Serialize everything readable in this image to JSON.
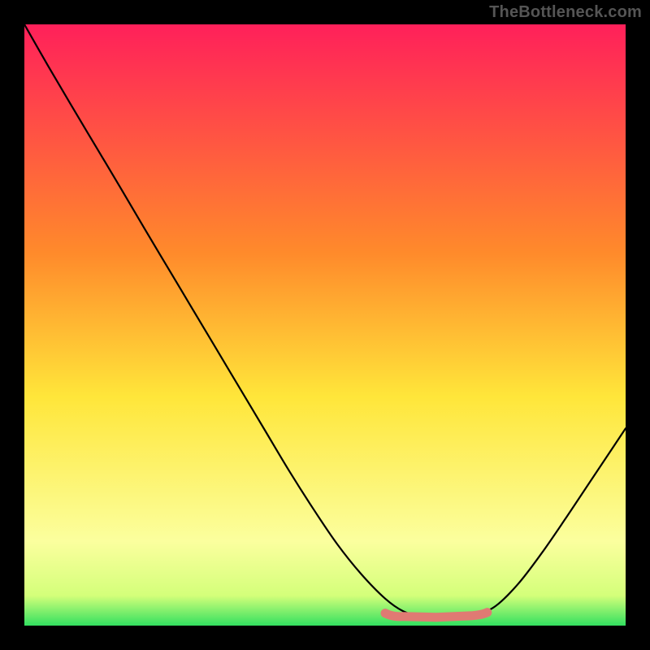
{
  "watermark": "TheBottleneck.com",
  "colors": {
    "frame": "#000000",
    "curve": "#000000",
    "band_fill": "#e07a73",
    "green_band": "#33e060",
    "gradient_top": "#ff205a",
    "gradient_mid1": "#ff8a2b",
    "gradient_mid2": "#ffe63a",
    "gradient_low": "#fbff9e",
    "gradient_bottom": "#33e060"
  },
  "chart_data": {
    "type": "line",
    "title": "",
    "xlabel": "",
    "ylabel": "",
    "xlim": [
      0,
      1
    ],
    "ylim": [
      0,
      1
    ],
    "grid": false,
    "series": [
      {
        "name": "bottleneck-curve",
        "x": [
          0.0,
          0.04,
          0.08,
          0.12,
          0.16,
          0.2,
          0.24,
          0.28,
          0.32,
          0.36,
          0.4,
          0.44,
          0.48,
          0.52,
          0.56,
          0.6,
          0.63,
          0.66,
          0.7,
          0.74,
          0.78,
          0.82,
          0.86,
          0.9,
          0.94,
          0.98,
          1.0
        ],
        "y": [
          1.0,
          0.93,
          0.862,
          0.795,
          0.728,
          0.66,
          0.593,
          0.526,
          0.459,
          0.392,
          0.325,
          0.258,
          0.195,
          0.136,
          0.086,
          0.045,
          0.024,
          0.015,
          0.013,
          0.016,
          0.03,
          0.068,
          0.12,
          0.178,
          0.238,
          0.298,
          0.328
        ]
      }
    ],
    "annotations": [
      {
        "name": "min-band",
        "x_start": 0.6,
        "x_end": 0.77,
        "y": 0.018
      }
    ]
  }
}
